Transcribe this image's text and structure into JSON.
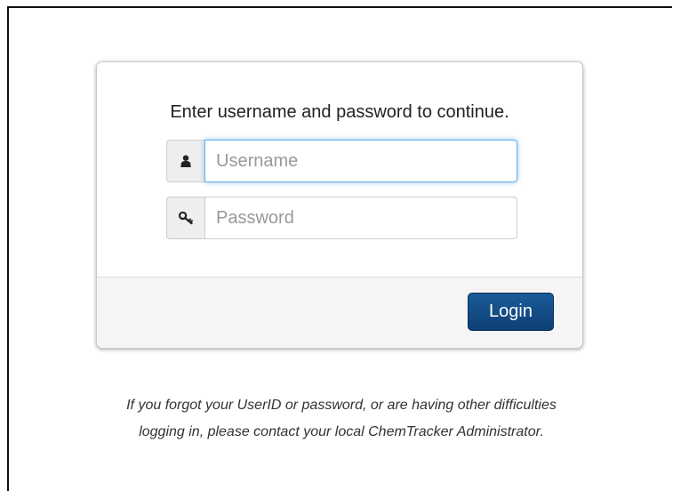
{
  "login_form": {
    "prompt": "Enter username and password to continue.",
    "username_placeholder": "Username",
    "password_placeholder": "Password",
    "login_label": "Login"
  },
  "help": {
    "line1": "If you forgot your UserID or password, or are having other difficulties",
    "line2": "logging in, please contact your local ChemTracker Administrator."
  },
  "icons": {
    "username": "user-icon",
    "password": "key-icon"
  },
  "colors": {
    "login_button": "#0d3f73",
    "focus_border": "#66afe9"
  }
}
